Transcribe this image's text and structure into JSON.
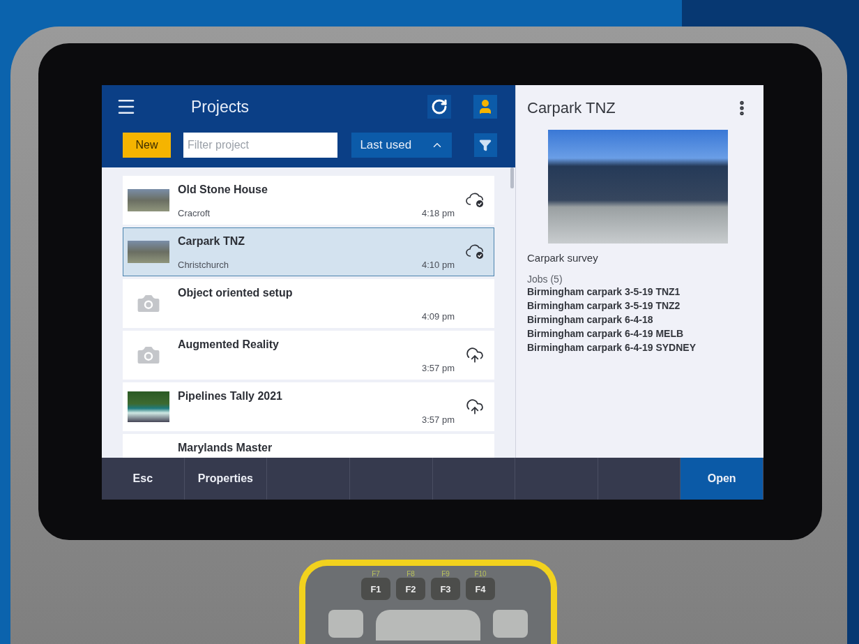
{
  "header": {
    "title": "Projects",
    "new_button": "New",
    "filter": {
      "placeholder": "Filter project"
    },
    "sort": {
      "label": "Last used"
    }
  },
  "projects": [
    {
      "kind": "photo",
      "name": "Old Stone House",
      "location": "Cracroft",
      "time": "4:18 pm",
      "synced": true,
      "upload": false,
      "selected": false
    },
    {
      "kind": "photo",
      "name": "Carpark TNZ",
      "location": "Christchurch",
      "time": "4:10 pm",
      "synced": true,
      "upload": false,
      "selected": true
    },
    {
      "kind": "camera",
      "name": "Object oriented setup",
      "time": "4:09 pm",
      "synced": false,
      "upload": false,
      "selected": false
    },
    {
      "kind": "camera",
      "name": "Augmented Reality",
      "time": "3:57 pm",
      "synced": false,
      "upload": true,
      "selected": false
    },
    {
      "kind": "photo",
      "name": "Pipelines Tally 2021",
      "time": "3:57 pm",
      "synced": false,
      "upload": true,
      "selected": false
    },
    {
      "kind": "partial",
      "name": "Marylands Master",
      "synced": false,
      "upload": false,
      "selected": false
    }
  ],
  "details": {
    "title": "Carpark TNZ",
    "description": "Carpark survey",
    "jobs_label": "Jobs (5)",
    "jobs": [
      "Birmingham carpark 3-5-19 TNZ1",
      "Birmingham carpark 3-5-19 TNZ2",
      "Birmingham carpark 6-4-18",
      "Birmingham carpark 6-4-19 MELB",
      "Birmingham carpark 6-4-19 SYDNEY"
    ]
  },
  "softkeys": [
    {
      "kind": "plain",
      "label": "Esc"
    },
    {
      "kind": "plain",
      "label": "Properties"
    },
    {
      "kind": "blank"
    },
    {
      "kind": "blank"
    },
    {
      "kind": "blank"
    },
    {
      "kind": "blank"
    },
    {
      "kind": "blank"
    },
    {
      "kind": "primary",
      "label": "Open"
    }
  ],
  "keypad": [
    {
      "label": "F1",
      "alt": "F7"
    },
    {
      "label": "F2",
      "alt": "F8"
    },
    {
      "label": "F3",
      "alt": "F9"
    },
    {
      "label": "F4",
      "alt": "F10"
    }
  ]
}
